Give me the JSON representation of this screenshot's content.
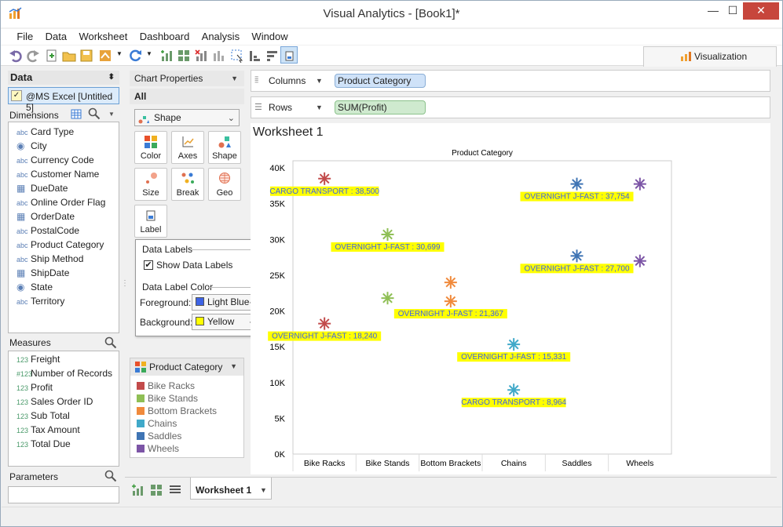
{
  "window": {
    "title": "Visual Analytics - [Book1]*",
    "minimize": "—",
    "maximize": "☐",
    "close": "✕"
  },
  "menu": [
    "File",
    "Data",
    "Worksheet",
    "Dashboard",
    "Analysis",
    "Window"
  ],
  "visualization_tab": "Visualization",
  "data_panel": {
    "title": "Data",
    "source": "@MS Excel [Untitled 5]",
    "dimensions_title": "Dimensions",
    "dimensions": [
      {
        "type": "abc",
        "label": "Card Type"
      },
      {
        "type": "geo",
        "label": "City"
      },
      {
        "type": "abc",
        "label": "Currency Code"
      },
      {
        "type": "abc",
        "label": "Customer Name"
      },
      {
        "type": "date",
        "label": "DueDate"
      },
      {
        "type": "abc",
        "label": "Online Order Flag"
      },
      {
        "type": "date",
        "label": "OrderDate"
      },
      {
        "type": "abc",
        "label": "PostalCode"
      },
      {
        "type": "abc",
        "label": "Product Category"
      },
      {
        "type": "abc",
        "label": "Ship Method"
      },
      {
        "type": "date",
        "label": "ShipDate"
      },
      {
        "type": "geo",
        "label": "State"
      },
      {
        "type": "abc",
        "label": "Territory"
      }
    ],
    "measures_title": "Measures",
    "measures": [
      {
        "type": "123",
        "label": "Freight"
      },
      {
        "type": "#123",
        "label": "Number of Records"
      },
      {
        "type": "123",
        "label": "Profit"
      },
      {
        "type": "123",
        "label": "Sales Order ID"
      },
      {
        "type": "123",
        "label": "Sub Total"
      },
      {
        "type": "123",
        "label": "Tax Amount"
      },
      {
        "type": "123",
        "label": "Total Due"
      }
    ],
    "parameters_title": "Parameters"
  },
  "chart_properties": {
    "title": "Chart Properties",
    "all_label": "All",
    "mark_type": "Shape",
    "buttons": [
      "Color",
      "Axes",
      "Shape",
      "Size",
      "Break",
      "Geo",
      "Label"
    ],
    "data_labels_group": "Data Labels",
    "show_data_labels": "Show Data Labels",
    "show_data_labels_checked": true,
    "label_color_group": "Data Label Color",
    "foreground_label": "Foreground:",
    "foreground_value": "Light Blue",
    "foreground_color": "#3d63e6",
    "background_label": "Background:",
    "background_value": "Yellow",
    "background_color": "#ffff00"
  },
  "legend": {
    "title": "Product Category",
    "items": [
      {
        "label": "Bike Racks",
        "color": "#c24b4b"
      },
      {
        "label": "Bike Stands",
        "color": "#8fbf55"
      },
      {
        "label": "Bottom Brackets",
        "color": "#f08a3c"
      },
      {
        "label": "Chains",
        "color": "#40a9c9"
      },
      {
        "label": "Saddles",
        "color": "#3f74b4"
      },
      {
        "label": "Wheels",
        "color": "#7c55a6"
      }
    ]
  },
  "shelves": {
    "columns_label": "Columns",
    "columns_pill": "Product Category",
    "rows_label": "Rows",
    "rows_pill": "SUM(Profit)"
  },
  "worksheet": {
    "title": "Worksheet 1",
    "tab": "Worksheet 1"
  },
  "chart_data": {
    "type": "scatter",
    "title": "Product Category",
    "xlabel": "",
    "ylabel": "",
    "categories": [
      "Bike Racks",
      "Bike Stands",
      "Bottom Brackets",
      "Chains",
      "Saddles",
      "Wheels"
    ],
    "y_ticks": [
      "0K",
      "5K",
      "10K",
      "15K",
      "20K",
      "25K",
      "30K",
      "35K",
      "40K"
    ],
    "ylim": [
      0,
      41000
    ],
    "points": [
      {
        "category": "Bike Racks",
        "y": 38500,
        "label": "CARGO TRANSPORT : 38,500",
        "color": "#c24b4b"
      },
      {
        "category": "Bike Racks",
        "y": 18240,
        "label": "OVERNIGHT J-FAST : 18,240",
        "color": "#c24b4b"
      },
      {
        "category": "Bike Stands",
        "y": 30699,
        "label": "OVERNIGHT J-FAST : 30,699",
        "color": "#8fbf55"
      },
      {
        "category": "Bike Stands",
        "y": 21800,
        "label": "",
        "color": "#8fbf55"
      },
      {
        "category": "Bottom Brackets",
        "y": 24000,
        "label": "",
        "color": "#f08a3c"
      },
      {
        "category": "Bottom Brackets",
        "y": 21367,
        "label": "OVERNIGHT J-FAST : 21,367",
        "color": "#f08a3c"
      },
      {
        "category": "Chains",
        "y": 15331,
        "label": "OVERNIGHT J-FAST : 15,331",
        "color": "#40a9c9"
      },
      {
        "category": "Chains",
        "y": 8964,
        "label": "CARGO TRANSPORT : 8,964",
        "color": "#40a9c9"
      },
      {
        "category": "Saddles",
        "y": 37754,
        "label": "OVERNIGHT J-FAST : 37,754",
        "color": "#3f74b4"
      },
      {
        "category": "Saddles",
        "y": 27700,
        "label": "OVERNIGHT J-FAST : 27,700",
        "color": "#3f74b4"
      },
      {
        "category": "Wheels",
        "y": 37754,
        "label": "",
        "color": "#7c55a6"
      },
      {
        "category": "Wheels",
        "y": 27000,
        "label": "",
        "color": "#7c55a6"
      }
    ],
    "label_background": "#ffff00",
    "label_foreground": "#3d63e6",
    "grid": false
  }
}
